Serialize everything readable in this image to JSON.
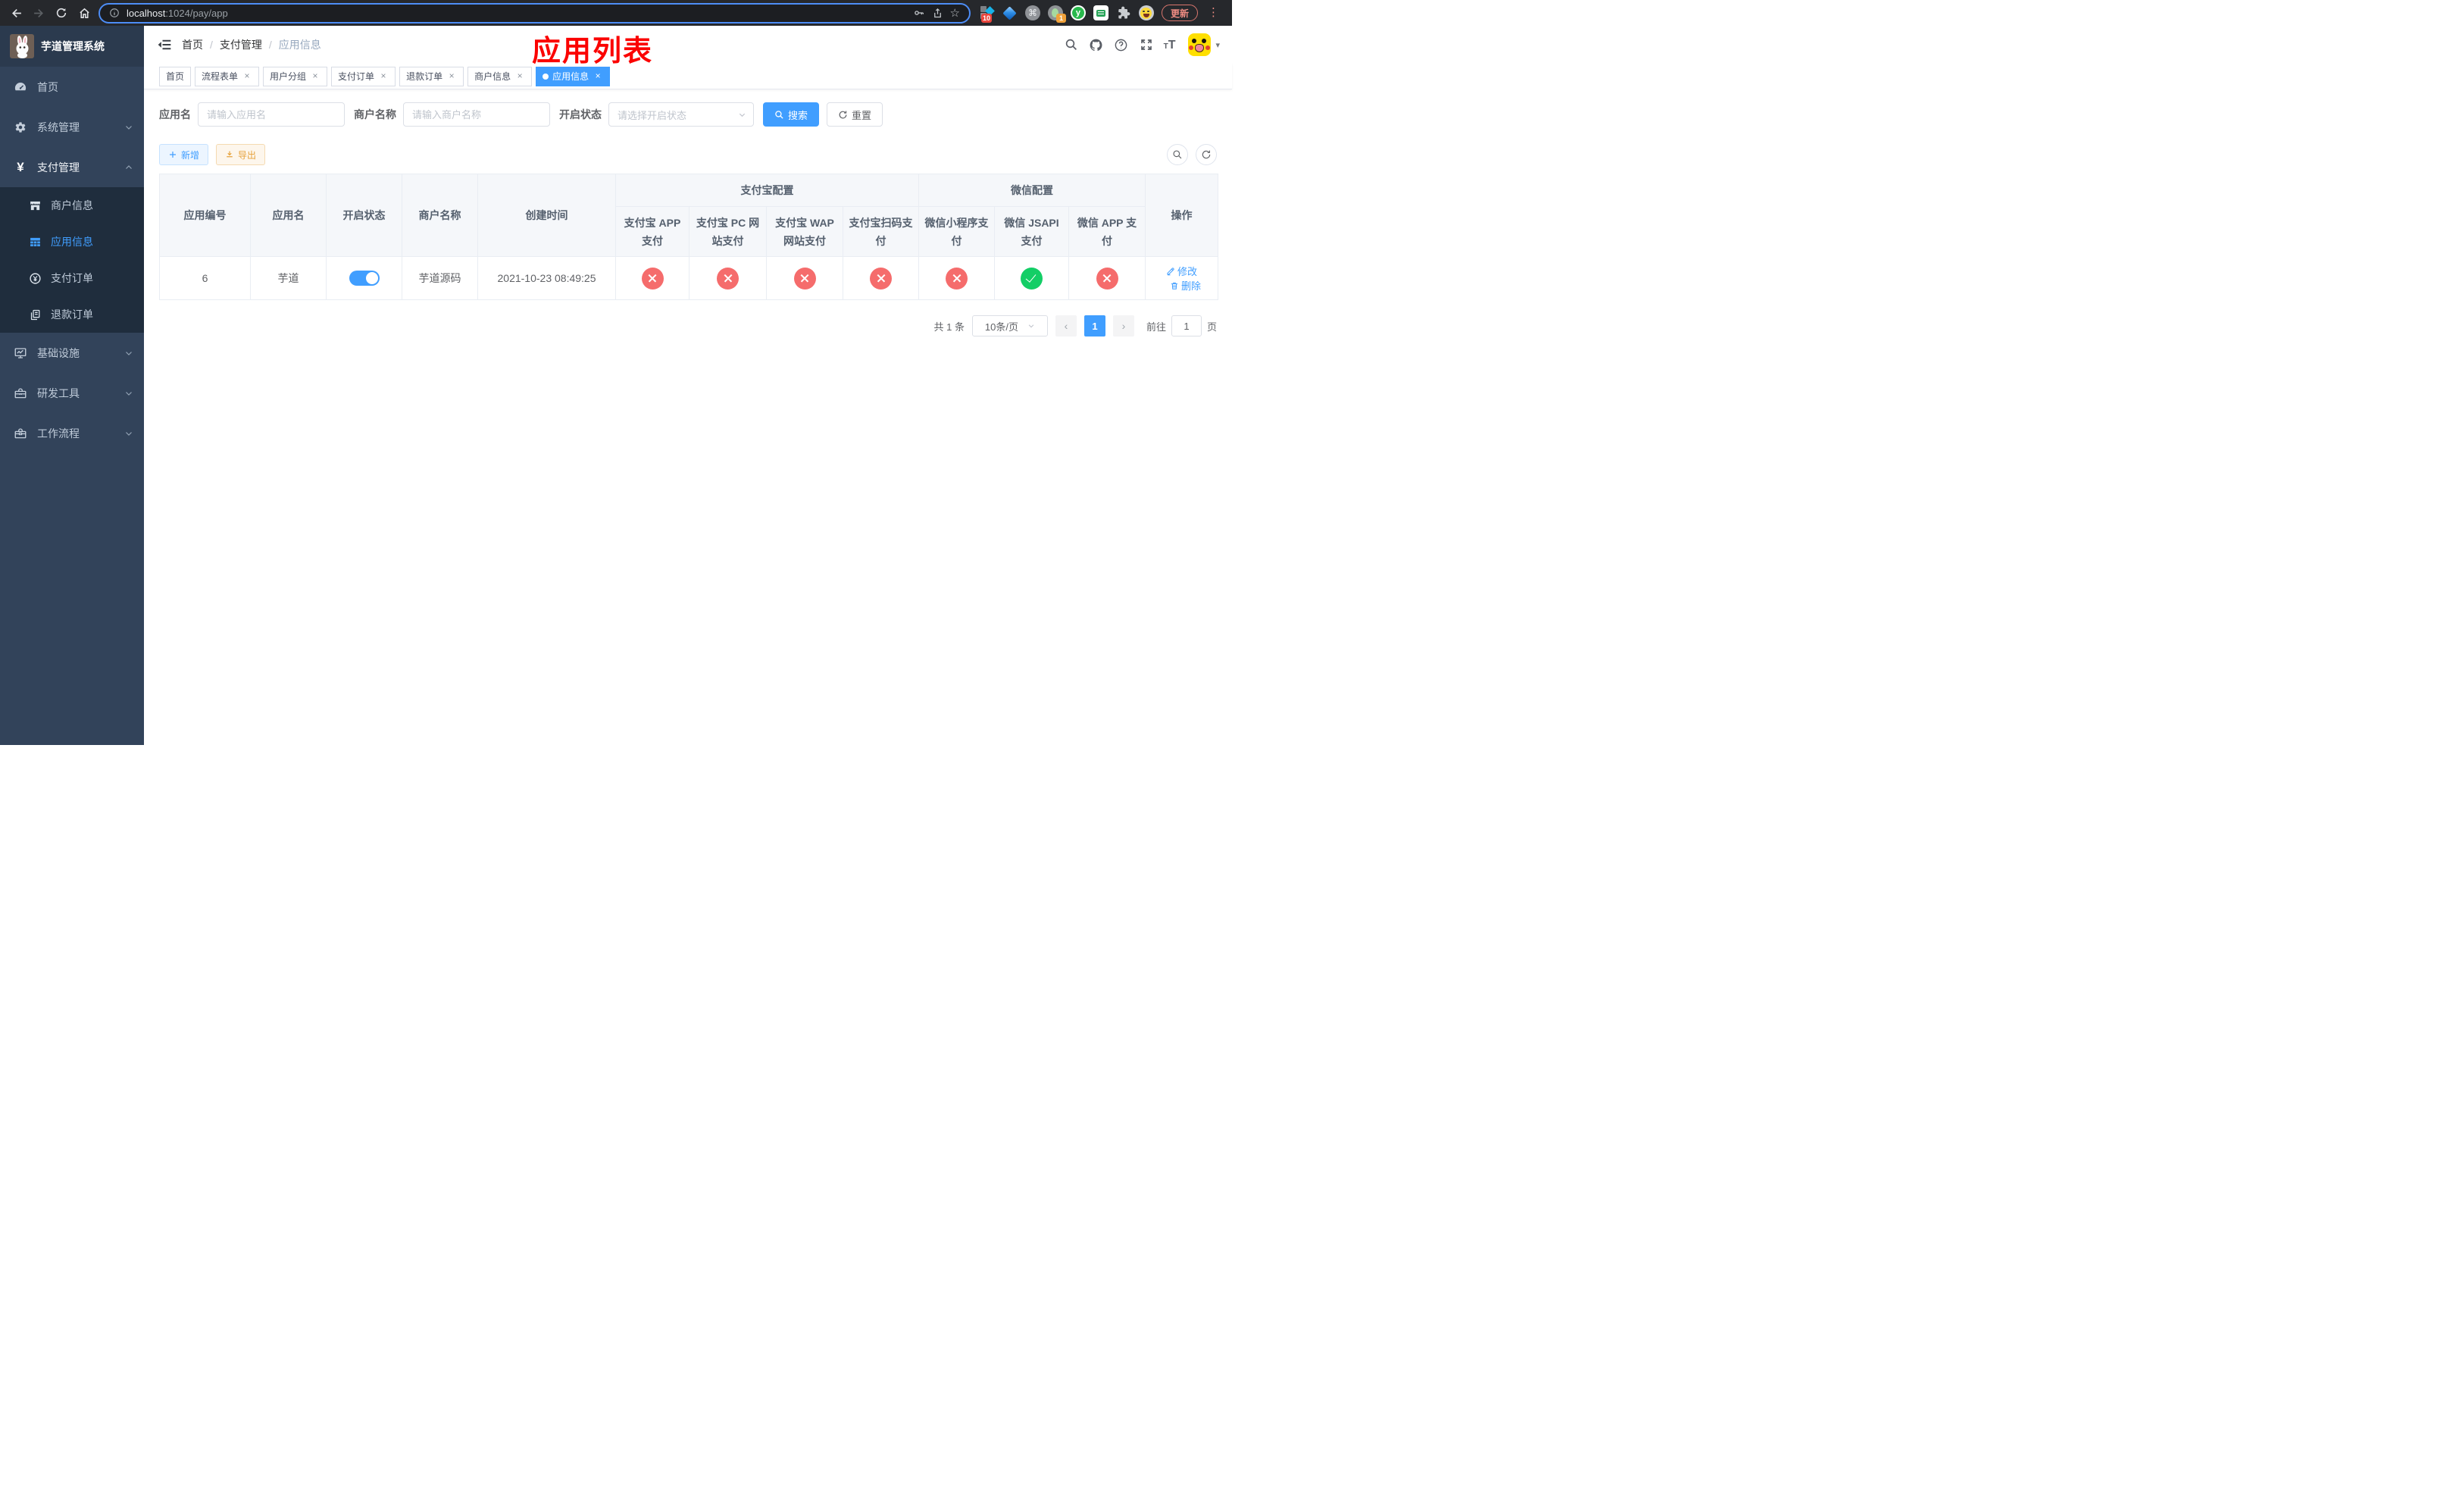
{
  "browser": {
    "url_host": "localhost",
    "url_path": ":1024/pay/app",
    "update_label": "更新",
    "badge_ten": "10",
    "badge_one": "1",
    "ext_y_letter": "y",
    "cmd_glyph": "⌘"
  },
  "sidebar": {
    "title": "芋道管理系统",
    "items": [
      {
        "label": "首页"
      },
      {
        "label": "系统管理"
      },
      {
        "label": "支付管理"
      },
      {
        "label": "基础设施"
      },
      {
        "label": "研发工具"
      },
      {
        "label": "工作流程"
      }
    ],
    "sub_items": [
      {
        "label": "商户信息"
      },
      {
        "label": "应用信息"
      },
      {
        "label": "支付订单"
      },
      {
        "label": "退款订单"
      }
    ]
  },
  "navbar": {
    "breadcrumb": [
      {
        "label": "首页"
      },
      {
        "label": "支付管理"
      },
      {
        "label": "应用信息"
      }
    ],
    "annotation": "应用列表"
  },
  "tags": [
    {
      "label": "首页"
    },
    {
      "label": "流程表单"
    },
    {
      "label": "用户分组"
    },
    {
      "label": "支付订单"
    },
    {
      "label": "退款订单"
    },
    {
      "label": "商户信息"
    },
    {
      "label": "应用信息"
    }
  ],
  "filters": {
    "app_name_label": "应用名",
    "app_name_placeholder": "请输入应用名",
    "merchant_label": "商户名称",
    "merchant_placeholder": "请输入商户名称",
    "status_label": "开启状态",
    "status_placeholder": "请选择开启状态",
    "search_label": "搜索",
    "reset_label": "重置"
  },
  "toolbar": {
    "add_label": "新增",
    "export_label": "导出"
  },
  "table": {
    "headers": {
      "app_id": "应用编号",
      "app_name": "应用名",
      "status": "开启状态",
      "merchant": "商户名称",
      "created": "创建时间",
      "alipay_group": "支付宝配置",
      "wechat_group": "微信配置",
      "alipay_app": "支付宝 APP 支付",
      "alipay_pc": "支付宝 PC 网站支付",
      "alipay_wap": "支付宝 WAP 网站支付",
      "alipay_qr": "支付宝扫码支付",
      "wx_lite": "微信小程序支付",
      "wx_jsapi": "微信 JSAPI 支付",
      "wx_app": "微信 APP 支付",
      "actions": "操作"
    },
    "row": {
      "app_id": "6",
      "app_name": "芋道",
      "status_on": true,
      "merchant": "芋道源码",
      "created": "2021-10-23 08:49:25",
      "channels": [
        false,
        false,
        false,
        false,
        false,
        true,
        false
      ],
      "edit_label": "修改",
      "delete_label": "删除"
    }
  },
  "pagination": {
    "total": "共 1 条",
    "page_size": "10条/页",
    "prev": "‹",
    "next": "›",
    "page": "1",
    "goto_label": "前往",
    "goto_value": "1",
    "page_unit": "页"
  },
  "icons": {
    "close": "×",
    "sep": "/",
    "caret": "▾",
    "dots": "⋮",
    "star": "☆",
    "yuan": "¥"
  },
  "colors": {
    "primary": "#409eff",
    "success": "#13ce66",
    "danger": "#f56c6c",
    "warning": "#e6a23c",
    "sidebar_bg": "#32435a",
    "submenu_bg": "#1f2d3d"
  }
}
